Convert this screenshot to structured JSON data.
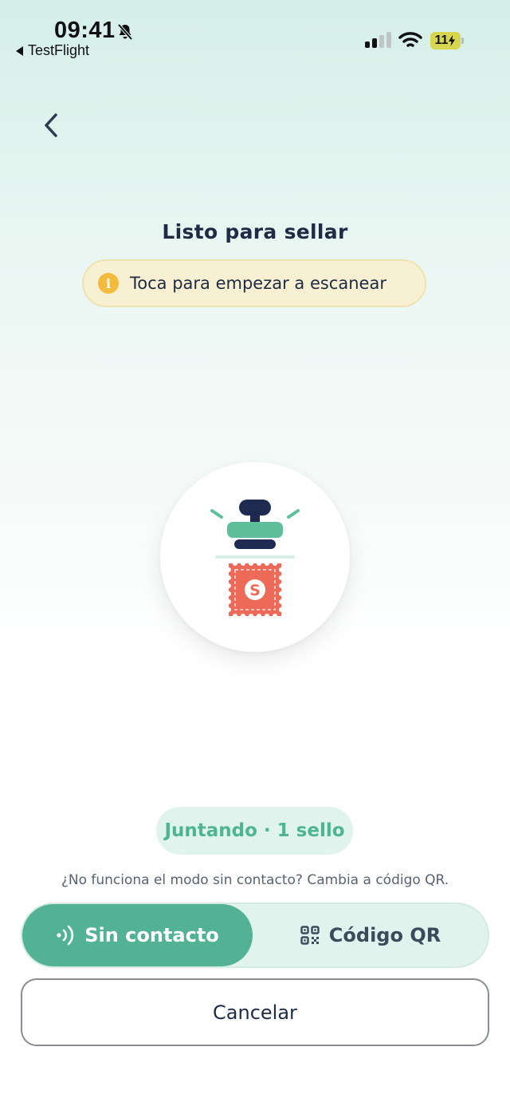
{
  "status_bar": {
    "time": "09:41",
    "back_app": "TestFlight",
    "battery": "11"
  },
  "screen": {
    "title": "Listo para sellar",
    "hint": "Toca para empezar a escanear",
    "stamp_letter": "S",
    "progress_status": "Juntando · 1 sello",
    "helper_text": "¿No funciona el modo sin contacto? Cambia a código QR."
  },
  "mode_toggle": {
    "selected": "contactless",
    "contactless_label": "Sin contacto",
    "qr_label": "Código QR"
  },
  "cancel_label": "Cancelar",
  "colors": {
    "accent": "#53b294",
    "accent_light": "#e0f3ec",
    "text_dark": "#1f2a44",
    "hint_bg": "#f8f0d2",
    "info_icon": "#f3bb3d",
    "stamp_red": "#ec6a57",
    "stamp_navy": "#1f2a50"
  },
  "icons": {
    "nav_back": "chevron-left-icon",
    "info": "info-icon",
    "contactless": "contactless-icon",
    "qr": "qr-code-icon",
    "illustration": "stamp-illustration-icon"
  }
}
